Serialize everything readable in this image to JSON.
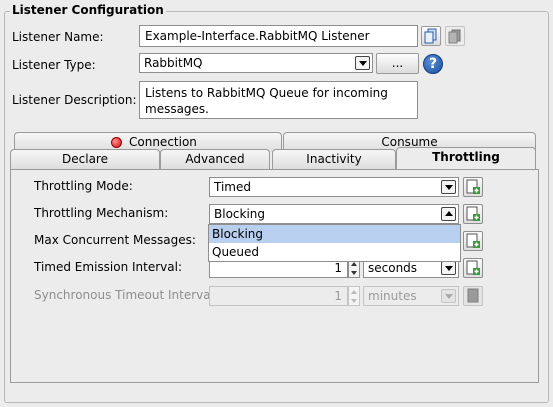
{
  "group": {
    "title": "Listener Configuration"
  },
  "listener": {
    "name_label": "Listener Name:",
    "name_value": "Example-Interface.RabbitMQ Listener",
    "type_label": "Listener Type:",
    "type_value": "RabbitMQ",
    "browse_label": "...",
    "help_label": "?",
    "description_label": "Listener Description:",
    "description_value": "Listens to RabbitMQ Queue for incoming messages."
  },
  "tabs": {
    "row1": [
      "Connection",
      "Consume"
    ],
    "row2": [
      "Declare",
      "Advanced",
      "Inactivity",
      "Throttling"
    ],
    "active": "Throttling",
    "connection_status_color": "#d01010"
  },
  "throttling": {
    "mode_label": "Throttling Mode:",
    "mode_value": "Timed",
    "mechanism_label": "Throttling Mechanism:",
    "mechanism_value": "Blocking",
    "mechanism_options": [
      "Blocking",
      "Queued"
    ],
    "mechanism_highlighted": "Blocking",
    "max_concurrent_label": "Max Concurrent Messages:",
    "timed_interval_label": "Timed Emission Interval:",
    "timed_interval_value": "1",
    "timed_interval_unit": "seconds",
    "sync_timeout_label": "Synchronous Timeout Interval:",
    "sync_timeout_value": "1",
    "sync_timeout_unit": "minutes"
  }
}
